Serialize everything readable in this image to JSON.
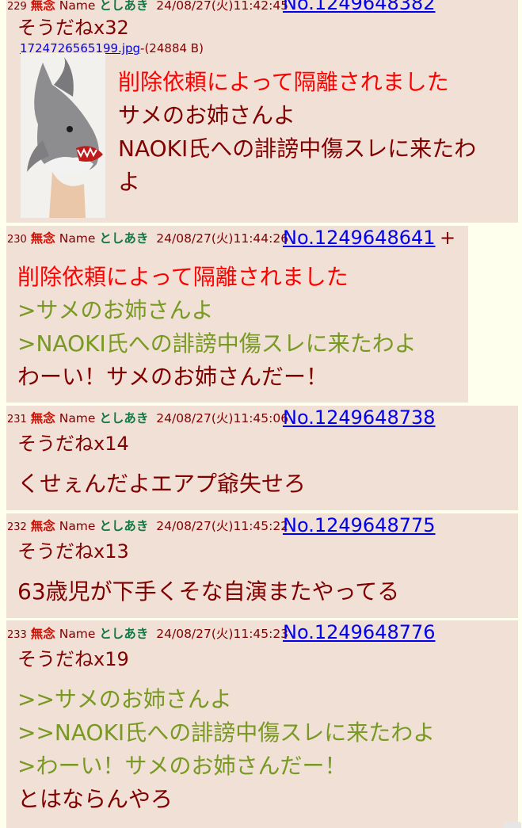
{
  "posts": [
    {
      "num": "229",
      "subject": "無念",
      "name_label": "Name",
      "name": "としあき",
      "date": "24/08/27(火)11:42:45",
      "no": "No.1249648382",
      "sou": "そうだねx32",
      "file": {
        "name": "1724726565199.jpg",
        "size": "-(24884 B)"
      },
      "lines": [
        {
          "text": "削除依頼によって隔離されました",
          "kind": "red"
        },
        {
          "text": "サメのお姉さんよ",
          "kind": "normal"
        },
        {
          "text": "NAOKI氏への誹謗中傷スレに来たわ",
          "kind": "normal"
        },
        {
          "text": "よ",
          "kind": "normal"
        }
      ]
    },
    {
      "num": "230",
      "subject": "無念",
      "name_label": "Name",
      "name": "としあき",
      "date": "24/08/27(火)11:44:26",
      "no": "No.1249648641",
      "plus": "+",
      "lines": [
        {
          "text": "削除依頼によって隔離されました",
          "kind": "red"
        },
        {
          "text": ">サメのお姉さんよ",
          "kind": "quote"
        },
        {
          "text": ">NAOKI氏への誹謗中傷スレに来たわよ",
          "kind": "quote"
        },
        {
          "text": "わーい！サメのお姉さんだー！",
          "kind": "normal"
        }
      ]
    },
    {
      "num": "231",
      "subject": "無念",
      "name_label": "Name",
      "name": "としあき",
      "date": "24/08/27(火)11:45:06",
      "no": "No.1249648738",
      "sou": "そうだねx14",
      "lines": [
        {
          "text": "くせぇんだよエアプ爺失せろ",
          "kind": "normal"
        }
      ]
    },
    {
      "num": "232",
      "subject": "無念",
      "name_label": "Name",
      "name": "としあき",
      "date": "24/08/27(火)11:45:22",
      "no": "No.1249648775",
      "sou": "そうだねx13",
      "lines": [
        {
          "text": "63歳児が下手くそな自演またやってる",
          "kind": "normal"
        }
      ]
    },
    {
      "num": "233",
      "subject": "無念",
      "name_label": "Name",
      "name": "としあき",
      "date": "24/08/27(火)11:45:23",
      "no": "No.1249648776",
      "sou": "そうだねx19",
      "lines": [
        {
          "text": ">>サメのお姉さんよ",
          "kind": "quote"
        },
        {
          "text": ">>NAOKI氏への誹謗中傷スレに来たわよ",
          "kind": "quote"
        },
        {
          "text": ">わーい！サメのお姉さんだー！",
          "kind": "quote"
        },
        {
          "text": "とはならんやろ",
          "kind": "normal"
        }
      ]
    }
  ],
  "colors": {
    "background": "#ffffee",
    "post_bg": "#f0e0d6",
    "text": "#800000",
    "subject": "#cc1105",
    "name": "#117743",
    "link": "#0000ee",
    "quote": "#789922",
    "deleted": "#ff0000"
  }
}
